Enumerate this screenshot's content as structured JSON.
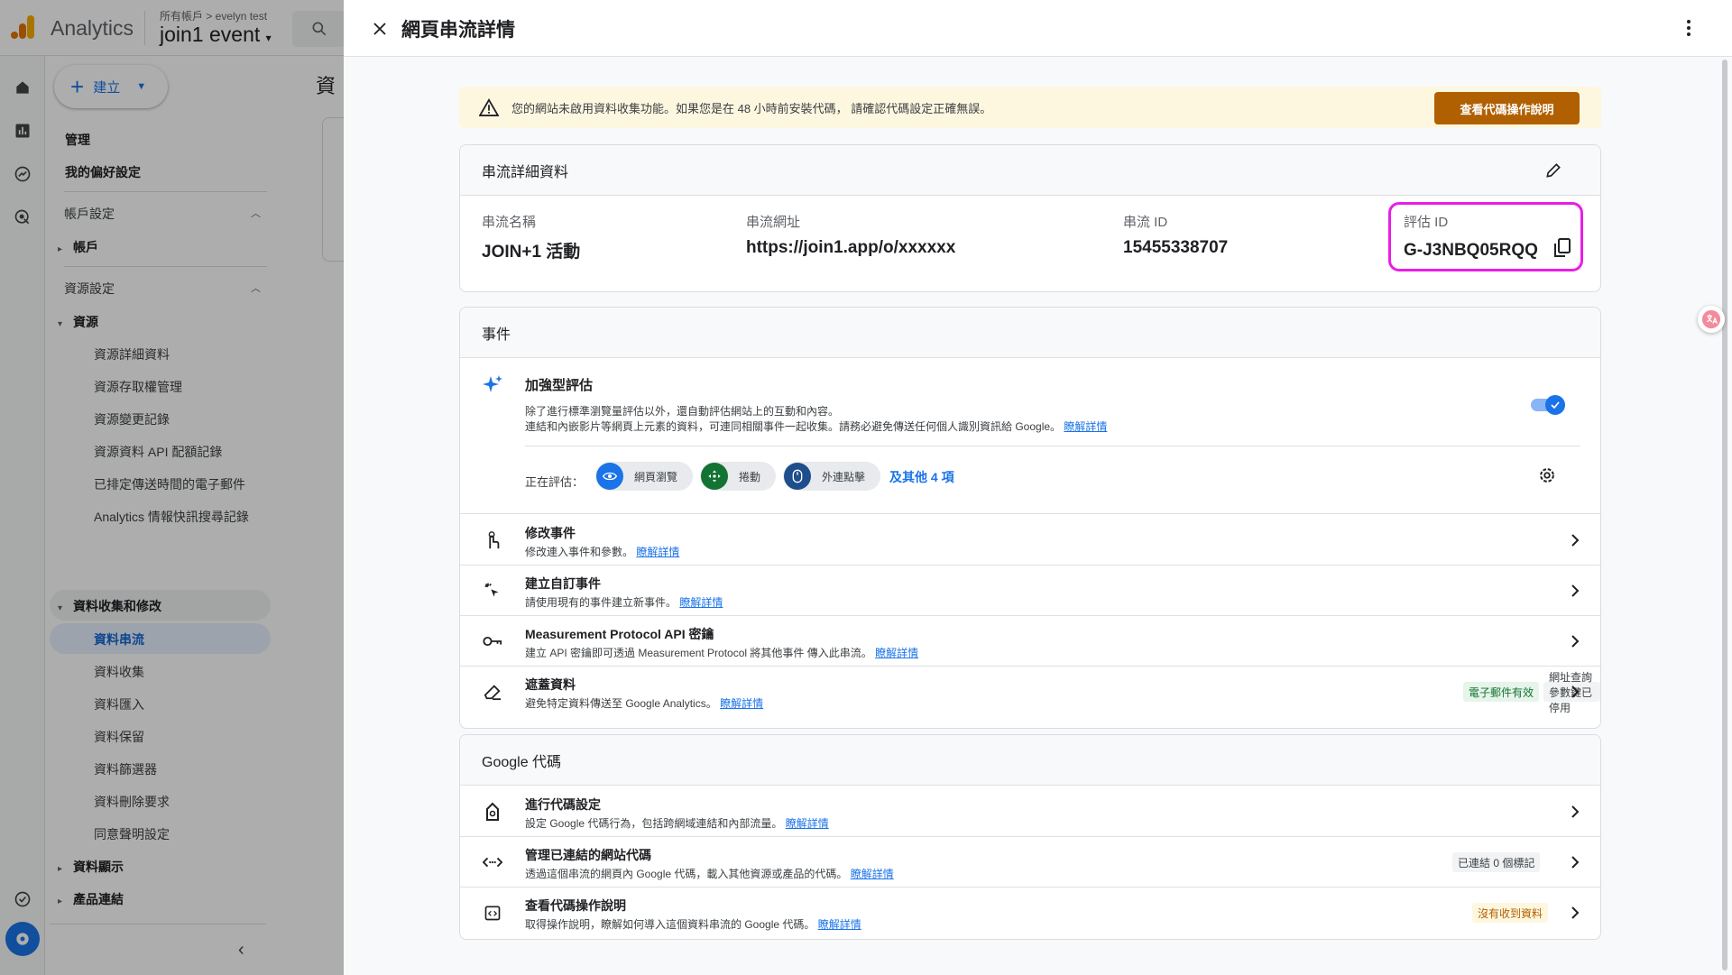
{
  "app": {
    "brand": "Analytics",
    "account_crumb": "所有帳戶 > evelyn test",
    "property_name": "join1 event"
  },
  "sidenav": {
    "create_label": "建立",
    "admin": "管理",
    "my_prefs": "我的偏好設定",
    "account_settings": "帳戶設定",
    "account": "帳戶",
    "property_settings": "資源設定",
    "property": "資源",
    "property_items": [
      "資源詳細資料",
      "資源存取權管理",
      "資源變更記錄",
      "資源資料 API 配額記錄",
      "已排定傳送時間的電子郵件",
      "Analytics 情報快訊搜尋記錄"
    ],
    "data_collection": "資料收集和修改",
    "data_items": [
      "資料串流",
      "資料收集",
      "資料匯入",
      "資料保留",
      "資料篩選器",
      "資料刪除要求",
      "同意聲明設定"
    ],
    "data_display": "資料顯示",
    "product_links": "產品連結"
  },
  "background": {
    "page_title_peek": "資"
  },
  "drawer": {
    "title": "網頁串流詳情",
    "alert": {
      "text": "您的網站未啟用資料收集功能。如果您是在 48 小時前安裝代碼， 請確認代碼設定正確無誤。",
      "button": "查看代碼操作說明"
    },
    "stream_details": {
      "header": "串流詳細資料",
      "name_label": "串流名稱",
      "name_value": "JOIN+1 活動",
      "url_label": "串流網址",
      "url_value": "https://join1.app/o/xxxxxx",
      "id_label": "串流 ID",
      "id_value": "15455338707",
      "measurement_label": "評估 ID",
      "measurement_value": "G-J3NBQ05RQQ"
    },
    "events": {
      "header": "事件",
      "enhanced_title": "加強型評估",
      "enhanced_desc1": "除了進行標準瀏覽量評估以外，還自動評估網站上的互動和內容。",
      "enhanced_desc2": "連結和內嵌影片等網頁上元素的資料，可連同相關事件一起收集。請務必避免傳送任何個人識別資訊給 Google。",
      "learn_more": "瞭解詳情",
      "measuring_label": "正在評估：",
      "chips": [
        "網頁瀏覽",
        "捲動",
        "外連點擊"
      ],
      "more": "及其他 4 項",
      "toggle_on": true,
      "rows": [
        {
          "title": "修改事件",
          "desc": "修改連入事件和參數。",
          "link": "瞭解詳情"
        },
        {
          "title": "建立自訂事件",
          "desc": "請使用現有的事件建立新事件。",
          "link": "瞭解詳情"
        },
        {
          "title": "Measurement Protocol API 密鑰",
          "desc": "建立 API 密鑰即可透過 Measurement Protocol 將其他事件 傳入此串流。",
          "link": "瞭解詳情"
        },
        {
          "title": "遮蓋資料",
          "desc": "避免特定資料傳送至 Google Analytics。",
          "link": "瞭解詳情",
          "badge1": "電子郵件有效",
          "badge2": "網址查詢參數鍵已停用"
        }
      ]
    },
    "google_tag": {
      "header": "Google 代碼",
      "rows": [
        {
          "title": "進行代碼設定",
          "desc": "設定 Google 代碼行為，包括跨網域連結和內部流量。",
          "link": "瞭解詳情"
        },
        {
          "title": "管理已連結的網站代碼",
          "desc": "透過這個串流的網頁內 Google 代碼，載入其他資源或產品的代碼。",
          "link": "瞭解詳情",
          "badge": "已連結 0 個標記"
        },
        {
          "title": "查看代碼操作說明",
          "desc": "取得操作說明，瞭解如何導入這個資料串流的 Google 代碼。",
          "link": "瞭解詳情",
          "badge": "沒有收到資料"
        }
      ]
    }
  },
  "colors": {
    "accent": "#1a73e8",
    "highlight": "#e91ee6",
    "alert_bg": "#fef7e0",
    "alert_btn": "#b06000"
  }
}
